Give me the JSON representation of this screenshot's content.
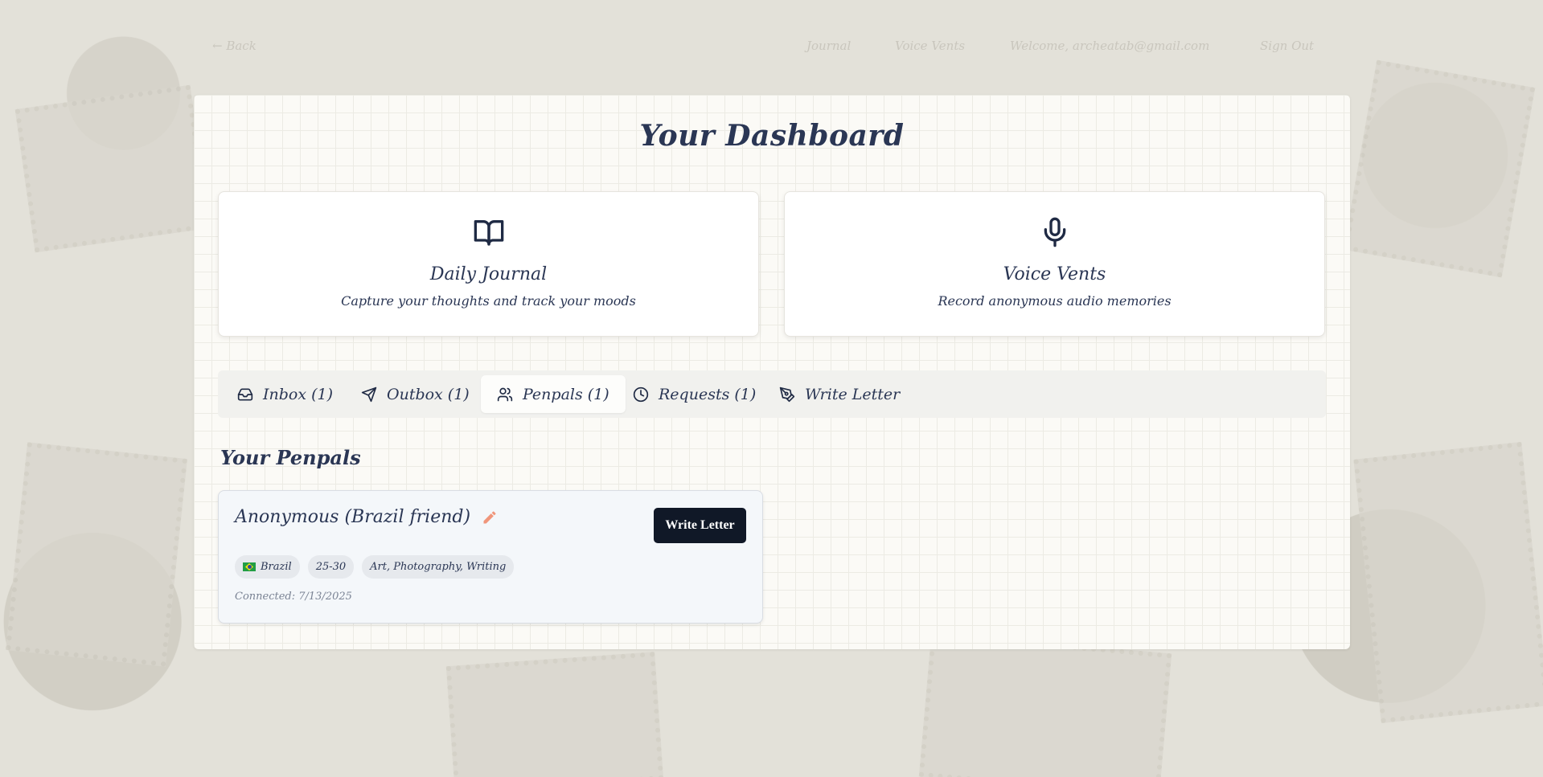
{
  "nav": {
    "back": "← Back",
    "journal": "Journal",
    "voice_vents": "Voice Vents",
    "welcome": "Welcome, archeatab@gmail.com",
    "sign_out": "Sign Out"
  },
  "dashboard": {
    "title": "Your Dashboard",
    "cards": [
      {
        "icon": "book-open-icon",
        "title": "Daily Journal",
        "description": "Capture your thoughts and track your moods"
      },
      {
        "icon": "microphone-icon",
        "title": "Voice Vents",
        "description": "Record anonymous audio memories"
      }
    ]
  },
  "tabs": [
    {
      "icon": "inbox-icon",
      "label": "Inbox (1)"
    },
    {
      "icon": "send-icon",
      "label": "Outbox (1)"
    },
    {
      "icon": "users-icon",
      "label": "Penpals (1)",
      "active": true
    },
    {
      "icon": "clock-icon",
      "label": "Requests (1)"
    },
    {
      "icon": "pen-tool-icon",
      "label": "Write Letter"
    }
  ],
  "penpals": {
    "heading": "Your Penpals",
    "items": [
      {
        "name": "Anonymous (Brazil friend)",
        "country": "Brazil",
        "age_range": "25-30",
        "interests": "Art, Photography, Writing",
        "connected": "Connected: 7/13/2025",
        "action_label": "Write Letter"
      }
    ]
  },
  "colors": {
    "accent_dark": "#101827",
    "text": "#2a3654",
    "edit_icon": "#f0957a"
  }
}
